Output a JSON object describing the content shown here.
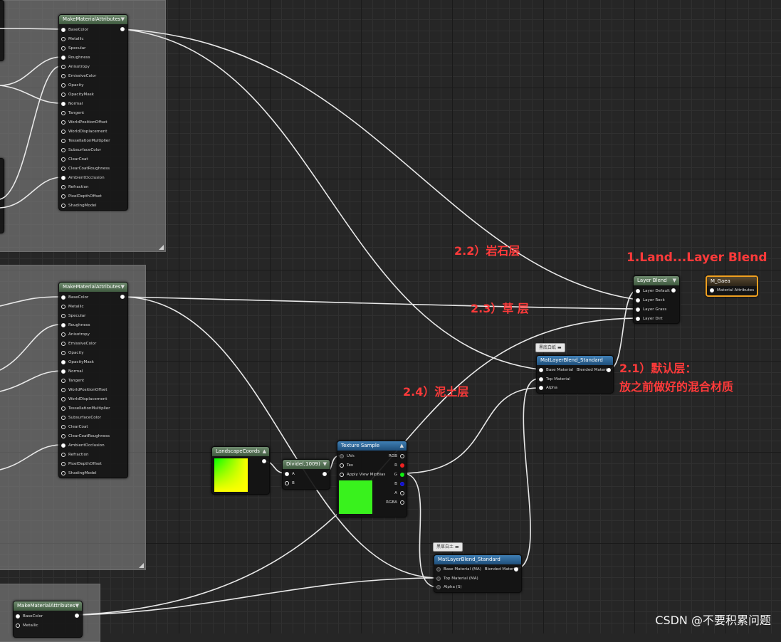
{
  "make_nodes": [
    {
      "title": "MakeMaterialAttributes",
      "pins": [
        "BaseColor",
        "Metallic",
        "Specular",
        "Roughness",
        "Anisotropy",
        "EmissiveColor",
        "Opacity",
        "OpacityMask",
        "Normal",
        "Tangent",
        "WorldPositionOffset",
        "WorldDisplacement",
        "TessellationMultiplier",
        "SubsurfaceColor",
        "ClearCoat",
        "ClearCoatRoughness",
        "AmbientOcclusion",
        "Refraction",
        "PixelDepthOffset",
        "ShadingModel"
      ]
    },
    {
      "title": "MakeMaterialAttributes",
      "pins": [
        "BaseColor",
        "Metallic",
        "Specular",
        "Roughness",
        "Anisotropy",
        "EmissiveColor",
        "Opacity",
        "OpacityMask",
        "Normal",
        "Tangent",
        "WorldPositionOffset",
        "WorldDisplacement",
        "TessellationMultiplier",
        "SubsurfaceColor",
        "ClearCoat",
        "ClearCoatRoughness",
        "AmbientOcclusion",
        "Refraction",
        "PixelDepthOffset",
        "ShadingModel"
      ]
    },
    {
      "title": "MakeMaterialAttributes",
      "pins": [
        "BaseColor",
        "Metallic"
      ]
    }
  ],
  "layer_blend": {
    "title": "Layer Blend",
    "pins": [
      "Layer Default",
      "Layer Rock",
      "Layer Grass",
      "Layer Dirt"
    ]
  },
  "m_gaea": {
    "title": "M_Gaea",
    "pin": "Material Attributes"
  },
  "mat_blend_top": {
    "tag": "黑底白纸",
    "title": "MatLayerBlend_Standard",
    "pins": [
      "Base Material",
      "Top Material",
      "Alpha"
    ],
    "output": "Blended Material"
  },
  "mat_blend_bottom": {
    "tag": "黑草白土",
    "title": "MatLayerBlend_Standard",
    "pins": [
      "Base Material (MA)",
      "Top Material (MA)",
      "Alpha (S)"
    ],
    "output": "Blended Material"
  },
  "landscape_coords": {
    "title": "LandscapeCoords"
  },
  "divide": {
    "title": "Divide(,1009)",
    "pins": [
      "A",
      "B"
    ]
  },
  "texture_sample": {
    "title": "Texture Sample",
    "inputs": [
      "UVs",
      "Tex",
      "Apply View MipBias"
    ],
    "outputs": [
      "RGB",
      "R",
      "G",
      "B",
      "A",
      "RGBA"
    ]
  },
  "annotations": {
    "layer_blend": "1.Land...Layer Blend",
    "rock": "2.2）岩石层",
    "grass": "2.3）草 层",
    "default_line1": "2.1）默认层：",
    "default_line2": "放之前做好的混合材质",
    "dirt": "2.4）泥土层"
  },
  "watermark": "CSDN @不要积累问题",
  "colors": {
    "annotation": "#ff3a3a",
    "node_header_green": "#4f6b4f",
    "node_header_blue": "#2f6a9a",
    "selected_outline": "#f0a020",
    "pin_r": "#e22222",
    "pin_g": "#11ee11",
    "pin_b": "#2222ee"
  }
}
